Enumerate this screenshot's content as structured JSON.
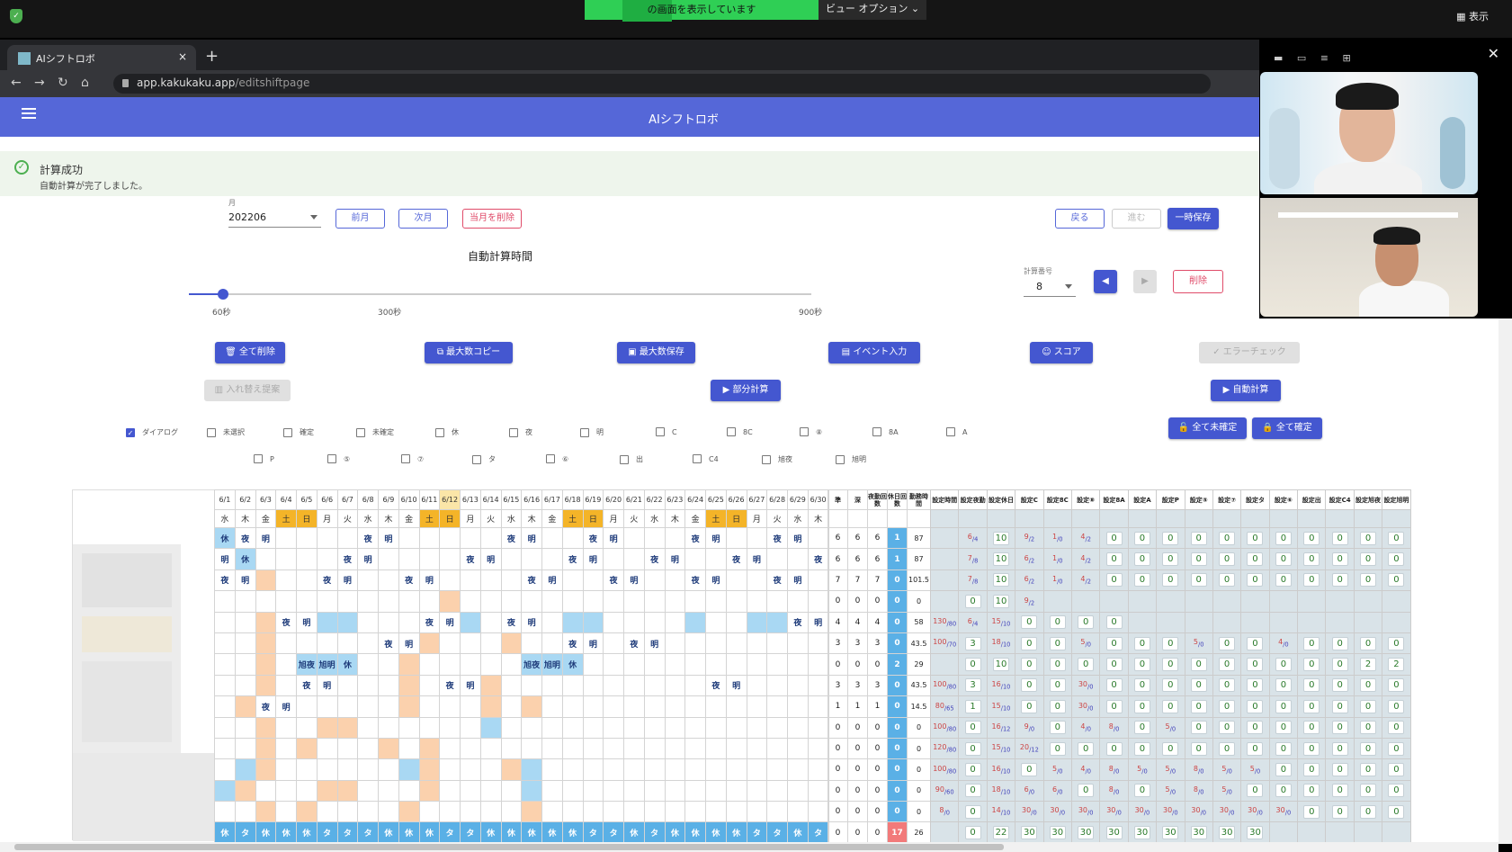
{
  "os_bar": {
    "share_text": "の画面を表示しています",
    "view_options": "ビュー オプション ⌄",
    "view_label": "表示"
  },
  "browser": {
    "tab_title": "AIシフトロボ",
    "tab_close": "×",
    "new_tab": "+",
    "url_host": "app.kakukaku.app",
    "url_path": "/editshiftpage"
  },
  "app": {
    "title": "AIシフトロボ",
    "alert_title": "計算成功",
    "alert_message": "自動計算が完了しました。",
    "month_label": "月",
    "month_value": "202206",
    "prev_month": "前月",
    "next_month": "次月",
    "delete_month": "当月を削除",
    "back": "戻る",
    "forward": "進む",
    "temp_save": "一時保存",
    "slider_title": "自動計算時間",
    "slider_ticks": [
      "60秒",
      "300秒",
      "900秒"
    ],
    "slider_value_fraction": 0.0,
    "calc_no_label": "計算番号",
    "calc_no_value": "8",
    "delete": "削除",
    "prev_arrow": "◀",
    "next_arrow": "▶",
    "actions": {
      "delete_all": "全て削除",
      "copy_max": "最大数コピー",
      "save_max": "最大数保存",
      "event_input": "イベント入力",
      "score": "スコア",
      "error_check": "エラーチェック",
      "swap_suggest": "入れ替え提案",
      "partial_calc": "部分計算",
      "auto_calc": "自動計算",
      "unconfirm_all": "全て未確定",
      "confirm_all": "全て確定"
    },
    "checkboxes_row1": [
      "ダイアログ",
      "未選択",
      "確定",
      "未確定",
      "休",
      "夜",
      "明",
      "C",
      "8C",
      "⑧",
      "8A",
      "A"
    ],
    "checkboxes_row2": [
      "P",
      "⑤",
      "⑦",
      "タ",
      "⑥",
      "出",
      "C4",
      "旭夜",
      "旭明"
    ],
    "checked": [
      0
    ]
  },
  "schedule": {
    "dates": [
      "6/1",
      "6/2",
      "6/3",
      "6/4",
      "6/5",
      "6/6",
      "6/7",
      "6/8",
      "6/9",
      "6/10",
      "6/11",
      "6/12",
      "6/13",
      "6/14",
      "6/15",
      "6/16",
      "6/17",
      "6/18",
      "6/19",
      "6/20",
      "6/21",
      "6/22",
      "6/23",
      "6/24",
      "6/25",
      "6/26",
      "6/27",
      "6/28",
      "6/29",
      "6/30"
    ],
    "weekdays": [
      "水",
      "木",
      "金",
      "土",
      "日",
      "月",
      "火",
      "水",
      "木",
      "金",
      "土",
      "日",
      "月",
      "火",
      "水",
      "木",
      "金",
      "土",
      "日",
      "月",
      "火",
      "水",
      "木",
      "金",
      "土",
      "日",
      "月",
      "火",
      "水",
      "木"
    ],
    "rows": [
      [
        "休",
        "夜",
        "明",
        "",
        "",
        "",
        "",
        "夜",
        "明",
        "",
        "",
        "",
        "",
        "",
        "夜",
        "明",
        "",
        "",
        "夜",
        "明",
        "",
        "",
        "",
        "夜",
        "明",
        "",
        "",
        "夜",
        "明",
        ""
      ],
      [
        "明",
        "休",
        "",
        "",
        "",
        "",
        "夜",
        "明",
        "",
        "",
        "",
        "",
        "夜",
        "明",
        "",
        "",
        "",
        "夜",
        "明",
        "",
        "",
        "夜",
        "明",
        "",
        "",
        "夜",
        "明",
        "",
        "",
        "夜"
      ],
      [
        "夜",
        "明",
        "",
        "",
        "",
        "夜",
        "明",
        "",
        "",
        "夜",
        "明",
        "",
        "",
        "",
        "",
        "夜",
        "明",
        "",
        "",
        "夜",
        "明",
        "",
        "",
        "夜",
        "明",
        "",
        "",
        "夜",
        "明",
        ""
      ],
      [
        "",
        "",
        "",
        "",
        "",
        "",
        "",
        "",
        "",
        "",
        "",
        "",
        "",
        "",
        "",
        "",
        "",
        "",
        "",
        "",
        "",
        "",
        "",
        "",
        "",
        "",
        "",
        "",
        "",
        ""
      ],
      [
        "",
        "",
        "",
        "夜",
        "明",
        "",
        "",
        "",
        "",
        "",
        "夜",
        "明",
        "",
        "",
        "夜",
        "明",
        "",
        "",
        "",
        "",
        "",
        "",
        "",
        "",
        "",
        "",
        "",
        "",
        "夜",
        "明"
      ],
      [
        "",
        "",
        "",
        "",
        "",
        "",
        "",
        "",
        "夜",
        "明",
        "",
        "",
        "",
        "",
        "",
        "",
        "",
        "夜",
        "明",
        "",
        "夜",
        "明",
        "",
        "",
        "",
        "",
        "",
        "",
        "",
        ""
      ],
      [
        "",
        "",
        "",
        "",
        "旭夜",
        "旭明",
        "休",
        "",
        "",
        "",
        "",
        "",
        "",
        "",
        "",
        "旭夜",
        "旭明",
        "休",
        "",
        "",
        "",
        "",
        "",
        "",
        "",
        "",
        "",
        "",
        "",
        ""
      ],
      [
        "",
        "",
        "",
        "",
        "夜",
        "明",
        "",
        "",
        "",
        "",
        "",
        "夜",
        "明",
        "",
        "",
        "",
        "",
        "",
        "",
        "",
        "",
        "",
        "",
        "",
        "夜",
        "明",
        "",
        "",
        "",
        ""
      ],
      [
        "",
        "",
        "夜",
        "明",
        "",
        "",
        "",
        "",
        "",
        "",
        "",
        "",
        "",
        "",
        "",
        "",
        "",
        "",
        "",
        "",
        "",
        "",
        "",
        "",
        "",
        "",
        "",
        "",
        "",
        ""
      ],
      [
        "",
        "",
        "",
        "",
        "",
        "",
        "",
        "",
        "",
        "",
        "",
        "",
        "",
        "",
        "",
        "",
        "",
        "",
        "",
        "",
        "",
        "",
        "",
        "",
        "",
        "",
        "",
        "",
        "",
        ""
      ],
      [
        "",
        "",
        "",
        "",
        "",
        "",
        "",
        "",
        "",
        "",
        "",
        "",
        "",
        "",
        "",
        "",
        "",
        "",
        "",
        "",
        "",
        "",
        "",
        "",
        "",
        "",
        "",
        "",
        "",
        ""
      ],
      [
        "",
        "",
        "",
        "",
        "",
        "",
        "",
        "",
        "",
        "",
        "",
        "",
        "",
        "",
        "",
        "",
        "",
        "",
        "",
        "",
        "",
        "",
        "",
        "",
        "",
        "",
        "",
        "",
        "",
        ""
      ],
      [
        "",
        "",
        "",
        "",
        "",
        "",
        "",
        "",
        "",
        "",
        "",
        "",
        "",
        "",
        "",
        "",
        "",
        "",
        "",
        "",
        "",
        "",
        "",
        "",
        "",
        "",
        "",
        "",
        "",
        ""
      ],
      [
        "",
        "",
        "",
        "",
        "",
        "",
        "",
        "",
        "",
        "",
        "",
        "",
        "",
        "",
        "",
        "",
        "",
        "",
        "",
        "",
        "",
        "",
        "",
        "",
        "",
        "",
        "",
        "",
        "",
        ""
      ],
      [
        "休",
        "タ",
        "休",
        "休",
        "休",
        "タ",
        "タ",
        "タ",
        "休",
        "休",
        "休",
        "タ",
        "タ",
        "休",
        "休",
        "休",
        "休",
        "休",
        "タ",
        "タ",
        "休",
        "タ",
        "休",
        "休",
        "休",
        "休",
        "タ",
        "タ",
        "休",
        "タ"
      ]
    ]
  },
  "stats": {
    "headers": [
      "準",
      "深",
      "夜勤回数",
      "休日回数",
      "勤務時間"
    ],
    "rows": [
      [
        "6",
        "6",
        "6",
        "1",
        "87"
      ],
      [
        "6",
        "6",
        "6",
        "1",
        "87"
      ],
      [
        "7",
        "7",
        "7",
        "0",
        "101.5"
      ],
      [
        "0",
        "0",
        "0",
        "0",
        "0"
      ],
      [
        "4",
        "4",
        "4",
        "0",
        "58"
      ],
      [
        "3",
        "3",
        "3",
        "0",
        "43.5"
      ],
      [
        "0",
        "0",
        "0",
        "2",
        "29"
      ],
      [
        "3",
        "3",
        "3",
        "0",
        "43.5"
      ],
      [
        "1",
        "1",
        "1",
        "0",
        "14.5"
      ],
      [
        "0",
        "0",
        "0",
        "0",
        "0"
      ],
      [
        "0",
        "0",
        "0",
        "0",
        "0"
      ],
      [
        "0",
        "0",
        "0",
        "0",
        "0"
      ],
      [
        "0",
        "0",
        "0",
        "0",
        "0"
      ],
      [
        "0",
        "0",
        "0",
        "0",
        "0"
      ],
      [
        "0",
        "0",
        "0",
        "17",
        "26"
      ]
    ]
  },
  "settings": {
    "headers": [
      "設定時間",
      "設定夜勤",
      "設定休日",
      "設定C",
      "設定8C",
      "設定⑧",
      "設定8A",
      "設定A",
      "設定P",
      "設定⑤",
      "設定⑦",
      "設定タ",
      "設定⑥",
      "設定出",
      "設定C4",
      "設定旭夜",
      "設定旭明"
    ],
    "rows": [
      [
        "",
        "6/4",
        "10",
        "9/2",
        "1/0",
        "4/2",
        "0",
        "0",
        "0",
        "0",
        "0",
        "0",
        "0",
        "0",
        "0",
        "0",
        "0"
      ],
      [
        "",
        "7/8",
        "10",
        "6/2",
        "1/0",
        "4/2",
        "0",
        "0",
        "0",
        "0",
        "0",
        "0",
        "0",
        "0",
        "0",
        "0",
        "0"
      ],
      [
        "",
        "7/8",
        "10",
        "6/2",
        "1/0",
        "4/2",
        "0",
        "0",
        "0",
        "0",
        "0",
        "0",
        "0",
        "0",
        "0",
        "0",
        "0"
      ],
      [
        "",
        "0",
        "10",
        "9/2",
        "",
        "",
        "",
        "",
        "",
        "",
        "",
        "",
        "",
        "",
        "",
        "",
        ""
      ],
      [
        "130/80",
        "6/4",
        "15/10",
        "0",
        "0",
        "0",
        "0",
        "",
        "",
        "",
        "",
        "",
        "",
        "",
        "",
        "",
        ""
      ],
      [
        "100/70",
        "3",
        "18/10",
        "0",
        "0",
        "5/0",
        "0",
        "0",
        "0",
        "5/0",
        "0",
        "0",
        "4/0",
        "0",
        "0",
        "0",
        "0"
      ],
      [
        "",
        "0",
        "10",
        "0",
        "0",
        "0",
        "0",
        "0",
        "0",
        "0",
        "0",
        "0",
        "0",
        "0",
        "0",
        "2",
        "2"
      ],
      [
        "100/80",
        "3",
        "16/10",
        "0",
        "0",
        "30/0",
        "0",
        "0",
        "0",
        "0",
        "0",
        "0",
        "0",
        "0",
        "0",
        "0",
        "0"
      ],
      [
        "80/65",
        "1",
        "15/10",
        "0",
        "0",
        "30/0",
        "0",
        "0",
        "0",
        "0",
        "0",
        "0",
        "0",
        "0",
        "0",
        "0",
        "0"
      ],
      [
        "100/80",
        "0",
        "16/12",
        "9/0",
        "0",
        "4/0",
        "8/0",
        "0",
        "5/0",
        "0",
        "0",
        "0",
        "0",
        "0",
        "0",
        "0",
        "0"
      ],
      [
        "120/80",
        "0",
        "15/10",
        "20/12",
        "0",
        "0",
        "0",
        "0",
        "0",
        "0",
        "0",
        "0",
        "0",
        "0",
        "0",
        "0",
        "0"
      ],
      [
        "100/80",
        "0",
        "16/10",
        "0",
        "5/0",
        "4/0",
        "8/0",
        "5/0",
        "5/0",
        "8/0",
        "5/0",
        "5/0",
        "0",
        "0",
        "0",
        "0",
        "0"
      ],
      [
        "90/60",
        "0",
        "18/10",
        "6/0",
        "6/0",
        "0",
        "8/0",
        "0",
        "5/0",
        "8/0",
        "5/0",
        "0",
        "0",
        "0",
        "0",
        "0",
        "0"
      ],
      [
        "8/0",
        "0",
        "14/10",
        "30/0",
        "30/0",
        "30/0",
        "30/0",
        "30/0",
        "30/0",
        "30/0",
        "30/0",
        "30/0",
        "30/0",
        "0",
        "0",
        "0",
        "0"
      ],
      [
        "",
        "0",
        "22",
        "30",
        "30",
        "30",
        "30",
        "30",
        "30",
        "30",
        "30",
        "30",
        "",
        "",
        "",
        "",
        ""
      ]
    ]
  },
  "colors": {
    "header_bg": "#5567d8",
    "weekend": "#f4b428",
    "night_bg": "#a9d8f3",
    "peach": "#fbd1ad",
    "shade": "#eef3f6"
  }
}
